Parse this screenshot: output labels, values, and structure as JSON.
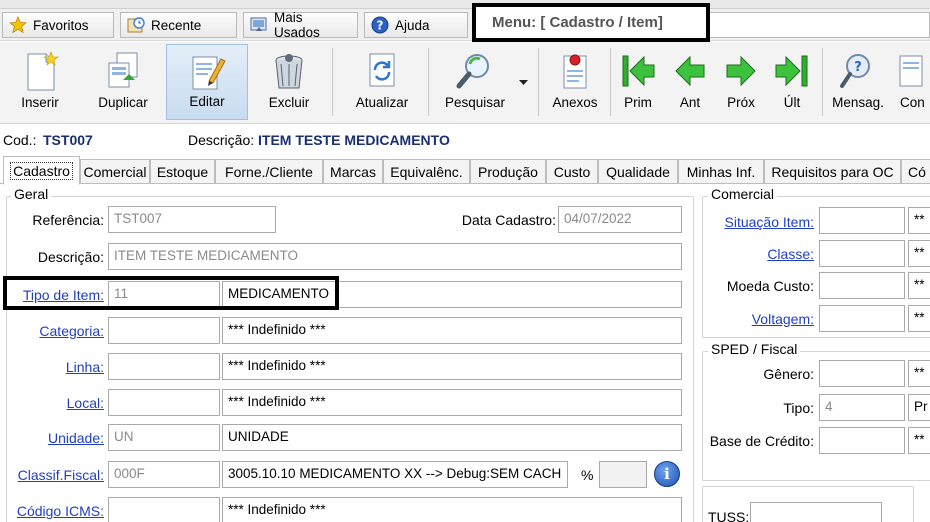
{
  "favbar": {
    "favoritos": "Favoritos",
    "recente": "Recente",
    "mais_usados": "Mais Usados",
    "ajuda": "Ajuda",
    "menu_title": "Menu: [ Cadastro / Item]"
  },
  "toolbar": {
    "inserir": "Inserir",
    "duplicar": "Duplicar",
    "editar": "Editar",
    "excluir": "Excluir",
    "atualizar": "Atualizar",
    "pesquisar": "Pesquisar",
    "anexos": "Anexos",
    "prim": "Prim",
    "ant": "Ant",
    "prox": "Próx",
    "ult": "Últ",
    "mensag": "Mensag.",
    "con": "Con"
  },
  "record": {
    "cod_label": "Cod.:",
    "cod_value": "TST007",
    "desc_label": "Descrição:",
    "desc_value": "ITEM TESTE MEDICAMENTO"
  },
  "tabs": [
    "Cadastro",
    "Comercial",
    "Estoque",
    "Forne./Cliente",
    "Marcas",
    "Equivalênc.",
    "Produção",
    "Custo",
    "Qualidade",
    "Minhas Inf.",
    "Requisitos para OC",
    "Có"
  ],
  "geral": {
    "title": "Geral",
    "referencia_label": "Referência:",
    "referencia_value": "TST007",
    "data_cadastro_label": "Data Cadastro:",
    "data_cadastro_value": "04/07/2022",
    "descricao_label": "Descrição:",
    "descricao_value": "ITEM TESTE MEDICAMENTO",
    "tipo_item_label": "Tipo de Item:",
    "tipo_item_code": "11",
    "tipo_item_desc": "MEDICAMENTO",
    "categoria_label": "Categoria:",
    "categoria_desc": "*** Indefinido ***",
    "linha_label": "Linha:",
    "linha_desc": "*** Indefinido ***",
    "local_label": "Local:",
    "local_desc": "*** Indefinido ***",
    "unidade_label": "Unidade:",
    "unidade_code": "UN",
    "unidade_desc": "UNIDADE",
    "classif_label": "Classif.Fiscal:",
    "classif_code": "000F",
    "classif_desc": "3005.10.10 MEDICAMENTO XX   --> Debug:SEM CACH",
    "percent_label": "%",
    "icms_label": "Código ICMS:",
    "icms_desc": "*** Indefinido ***"
  },
  "comercial": {
    "title": "Comercial",
    "situacao_label": "Situação Item:",
    "classe_label": "Classe:",
    "moeda_label": "Moeda Custo:",
    "voltagem_label": "Voltagem:",
    "stars": "**"
  },
  "sped": {
    "title": "SPED / Fiscal",
    "genero_label": "Gênero:",
    "tipo_label": "Tipo:",
    "tipo_value": "4",
    "tipo_desc": "Pr",
    "base_label": "Base de Crédito:",
    "stars": "**"
  },
  "tuss": {
    "label": "TUSS:"
  }
}
